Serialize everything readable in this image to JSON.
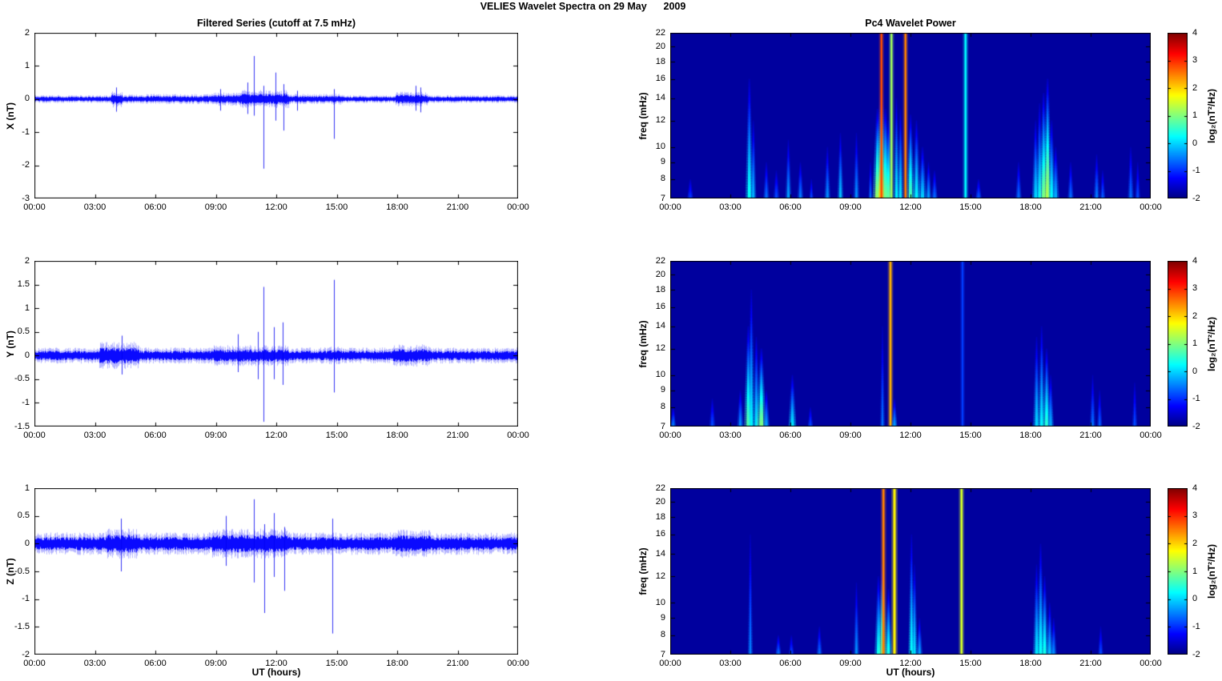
{
  "figure": {
    "title": "VELIES Wavelet Spectra on 29 May      2009",
    "background": "#ffffff"
  },
  "chart_data": {
    "type": "multi-panel",
    "panel_types": [
      "line",
      "heatmap"
    ],
    "left_title": "Filtered Series (cutoff at 7.5 mHz)",
    "right_title": "Pc4 Wavelet Power",
    "xlabel": "UT (hours)",
    "freq_label": "freq (mHz)",
    "series_color": "#0000ff",
    "frame_color": "#000000",
    "time_axis": {
      "range_hours": [
        0,
        24
      ],
      "tick_hours": [
        0,
        3,
        6,
        9,
        12,
        15,
        18,
        21,
        24
      ],
      "tick_labels": [
        "00:00",
        "03:00",
        "06:00",
        "09:00",
        "12:00",
        "15:00",
        "18:00",
        "21:00",
        "00:00"
      ]
    },
    "timeseries": [
      {
        "name": "X",
        "ylabel": "X (nT)",
        "ylim": [
          -3,
          2
        ],
        "ytick_values": [
          2,
          1,
          0,
          -1,
          -2,
          -3
        ],
        "ytick_labels": [
          "2",
          "1",
          "0",
          "-1",
          "-2",
          "-3"
        ],
        "noise_segments": [
          [
            0,
            3.8,
            0.07
          ],
          [
            3.8,
            4.35,
            0.15
          ],
          [
            4.35,
            5.5,
            0.08
          ],
          [
            5.5,
            8.8,
            0.09
          ],
          [
            8.8,
            10.2,
            0.12
          ],
          [
            10.2,
            12.6,
            0.16
          ],
          [
            12.6,
            14.4,
            0.09
          ],
          [
            14.4,
            15.3,
            0.1
          ],
          [
            15.3,
            17.9,
            0.07
          ],
          [
            17.9,
            19.5,
            0.13
          ],
          [
            19.5,
            24,
            0.07
          ]
        ],
        "spikes": [
          [
            4.05,
            0.35,
            -0.38
          ],
          [
            9.2,
            0.3,
            -0.35
          ],
          [
            10.55,
            0.5,
            -0.45
          ],
          [
            10.9,
            1.3,
            -0.5
          ],
          [
            11.35,
            0.4,
            -2.1
          ],
          [
            11.95,
            0.8,
            -0.65
          ],
          [
            12.35,
            0.45,
            -0.95
          ],
          [
            13.05,
            0.25,
            -0.35
          ],
          [
            14.85,
            0.3,
            -1.2
          ],
          [
            18.9,
            0.4,
            -0.35
          ],
          [
            19.15,
            0.35,
            -0.4
          ]
        ]
      },
      {
        "name": "Y",
        "ylabel": "Y (nT)",
        "ylim": [
          -1.5,
          2
        ],
        "ytick_values": [
          2,
          1.5,
          1,
          0.5,
          0,
          -0.5,
          -1,
          -1.5
        ],
        "ytick_labels": [
          "2",
          "1.5",
          "1",
          "0.5",
          "0",
          "-0.5",
          "-1",
          "-1.5"
        ],
        "noise_segments": [
          [
            0,
            3.2,
            0.1
          ],
          [
            3.2,
            5.2,
            0.17
          ],
          [
            5.2,
            8.9,
            0.1
          ],
          [
            8.9,
            12.6,
            0.13
          ],
          [
            12.6,
            14.5,
            0.1
          ],
          [
            14.5,
            15.1,
            0.11
          ],
          [
            15.1,
            17.8,
            0.1
          ],
          [
            17.8,
            19.6,
            0.14
          ],
          [
            19.6,
            24,
            0.1
          ]
        ],
        "spikes": [
          [
            4.35,
            0.42,
            -0.4
          ],
          [
            10.1,
            0.45,
            -0.35
          ],
          [
            11.1,
            0.5,
            -0.5
          ],
          [
            11.35,
            1.45,
            -1.4
          ],
          [
            11.9,
            0.6,
            -0.5
          ],
          [
            12.3,
            0.7,
            -0.62
          ],
          [
            14.85,
            1.6,
            -0.78
          ]
        ]
      },
      {
        "name": "Z",
        "ylabel": "Z (nT)",
        "ylim": [
          -2,
          1
        ],
        "ytick_values": [
          1,
          0.5,
          0,
          -0.5,
          -1,
          -1.5,
          -2
        ],
        "ytick_labels": [
          "1",
          "0.5",
          "0",
          "-0.5",
          "-1",
          "-1.5",
          "-2"
        ],
        "noise_segments": [
          [
            0,
            3.5,
            0.12
          ],
          [
            3.5,
            5.1,
            0.16
          ],
          [
            5.1,
            8.8,
            0.12
          ],
          [
            8.8,
            12.6,
            0.16
          ],
          [
            12.6,
            17.9,
            0.12
          ],
          [
            17.9,
            19.6,
            0.15
          ],
          [
            19.6,
            24,
            0.12
          ]
        ],
        "spikes": [
          [
            4.3,
            0.45,
            -0.5
          ],
          [
            9.5,
            0.5,
            -0.4
          ],
          [
            10.9,
            0.8,
            -0.7
          ],
          [
            11.4,
            0.35,
            -1.25
          ],
          [
            11.9,
            0.55,
            -0.6
          ],
          [
            12.4,
            0.3,
            -0.85
          ],
          [
            14.8,
            0.45,
            -1.62
          ]
        ]
      }
    ],
    "spectrograms": [
      {
        "name": "X",
        "flim": [
          7,
          22
        ],
        "fscale": "log",
        "ftick_values": [
          22,
          20,
          18,
          16,
          14,
          12,
          10,
          9,
          8,
          7
        ],
        "ftick_labels": [
          "22",
          "20",
          "18",
          "16",
          "14",
          "12",
          "10",
          "9",
          "8",
          "7"
        ],
        "background_value": -1.82,
        "events": [
          [
            1.0,
            8,
            -0.9,
            1.5
          ],
          [
            3.95,
            16,
            0.3,
            2
          ],
          [
            4.15,
            12,
            -0.2,
            1.5
          ],
          [
            4.8,
            9,
            -0.6,
            1.5
          ],
          [
            5.3,
            8.5,
            -0.8,
            1.5
          ],
          [
            5.9,
            10.5,
            -0.3,
            1.5
          ],
          [
            6.5,
            9,
            -0.5,
            1.5
          ],
          [
            7.05,
            8,
            -0.8,
            1
          ],
          [
            7.85,
            10,
            -0.4,
            1.5
          ],
          [
            8.5,
            11,
            -0.1,
            1.5
          ],
          [
            9.3,
            11,
            -0.4,
            1.5
          ],
          [
            10.0,
            9,
            -0.6,
            1
          ],
          [
            10.35,
            13,
            0.9,
            2.5
          ],
          [
            10.55,
            14.5,
            1.6,
            3.5
          ],
          [
            10.75,
            13,
            1.0,
            2.5
          ],
          [
            10.55,
            22,
            2.8,
            1.2
          ],
          [
            10.9,
            12,
            0.8,
            2
          ],
          [
            11.05,
            22,
            1.2,
            1.2
          ],
          [
            11.3,
            14,
            0.2,
            1.5
          ],
          [
            11.5,
            13,
            0.1,
            1.5
          ],
          [
            11.75,
            22,
            2.5,
            1.2
          ],
          [
            12.0,
            12.5,
            0.7,
            2
          ],
          [
            12.3,
            12,
            0.2,
            2
          ],
          [
            12.6,
            10,
            0.0,
            2
          ],
          [
            12.9,
            9,
            -0.3,
            1.5
          ],
          [
            13.2,
            8.5,
            -0.6,
            1.5
          ],
          [
            14.75,
            22,
            0.2,
            1.3
          ],
          [
            15.4,
            8,
            -0.7,
            1.5
          ],
          [
            17.4,
            9,
            -0.6,
            1.5
          ],
          [
            18.25,
            12,
            0.0,
            1.8
          ],
          [
            18.45,
            13.5,
            0.2,
            1.8
          ],
          [
            18.65,
            14.5,
            0.9,
            2.2
          ],
          [
            18.85,
            16,
            1.3,
            2.2
          ],
          [
            19.05,
            12,
            0.3,
            1.8
          ],
          [
            19.25,
            10,
            -0.2,
            1.8
          ],
          [
            20.0,
            9,
            -0.6,
            1.5
          ],
          [
            21.3,
            9.5,
            -0.5,
            1.5
          ],
          [
            21.6,
            8.5,
            -0.7,
            1.3
          ],
          [
            23.0,
            10,
            -0.6,
            1.5
          ],
          [
            23.35,
            9,
            -0.8,
            1.3
          ]
        ]
      },
      {
        "name": "Y",
        "flim": [
          7,
          22
        ],
        "fscale": "log",
        "ftick_values": [
          22,
          20,
          18,
          16,
          14,
          12,
          10,
          9,
          8,
          7
        ],
        "ftick_labels": [
          "22",
          "20",
          "18",
          "16",
          "14",
          "12",
          "10",
          "9",
          "8",
          "7"
        ],
        "background_value": -1.82,
        "events": [
          [
            0.15,
            8,
            -0.5,
            1.3
          ],
          [
            2.1,
            8.5,
            -0.8,
            1.5
          ],
          [
            3.5,
            9,
            -0.4,
            1.6
          ],
          [
            3.9,
            14,
            0.8,
            2.2
          ],
          [
            4.05,
            18,
            0.2,
            1.8
          ],
          [
            4.3,
            13,
            0.1,
            1.8
          ],
          [
            4.55,
            12,
            1.0,
            2.4
          ],
          [
            4.8,
            9,
            -0.3,
            1.6
          ],
          [
            6.1,
            10,
            0.1,
            2.0
          ],
          [
            7.0,
            8,
            -0.8,
            1.3
          ],
          [
            10.6,
            14,
            -0.6,
            1.2
          ],
          [
            11.0,
            22,
            2.2,
            1.3
          ],
          [
            11.2,
            8.5,
            -0.3,
            1.4
          ],
          [
            14.6,
            22,
            -0.9,
            1.1
          ],
          [
            18.3,
            13,
            0.0,
            1.8
          ],
          [
            18.55,
            14,
            0.2,
            1.8
          ],
          [
            18.8,
            12,
            0.5,
            2.0
          ],
          [
            19.0,
            10,
            -0.2,
            1.6
          ],
          [
            21.1,
            10,
            -0.6,
            1.4
          ],
          [
            21.45,
            9,
            -0.7,
            1.3
          ],
          [
            23.2,
            9.5,
            -0.8,
            1.3
          ]
        ]
      },
      {
        "name": "Z",
        "flim": [
          7,
          22
        ],
        "fscale": "log",
        "ftick_values": [
          22,
          20,
          18,
          16,
          14,
          12,
          10,
          9,
          8,
          7
        ],
        "ftick_labels": [
          "22",
          "20",
          "18",
          "16",
          "14",
          "12",
          "10",
          "9",
          "8",
          "7"
        ],
        "background_value": -1.82,
        "events": [
          [
            4.0,
            16,
            -0.5,
            1.3
          ],
          [
            5.4,
            8,
            -0.6,
            1.4
          ],
          [
            6.05,
            8,
            -0.8,
            1.3
          ],
          [
            7.45,
            8.5,
            -0.6,
            1.4
          ],
          [
            9.3,
            11.5,
            -0.4,
            1.4
          ],
          [
            10.4,
            12,
            0.3,
            2.0
          ],
          [
            10.6,
            13,
            0.8,
            2.4
          ],
          [
            10.65,
            22,
            2.5,
            1.3
          ],
          [
            10.9,
            11,
            0.4,
            1.8
          ],
          [
            11.2,
            22,
            1.8,
            1.5
          ],
          [
            12.05,
            16,
            0.3,
            1.6
          ],
          [
            12.2,
            13,
            0.1,
            1.5
          ],
          [
            12.45,
            9,
            -0.3,
            1.5
          ],
          [
            14.55,
            22,
            1.5,
            1.3
          ],
          [
            18.3,
            13,
            0.1,
            1.8
          ],
          [
            18.5,
            15,
            0.3,
            1.8
          ],
          [
            18.7,
            12,
            0.4,
            1.9
          ],
          [
            18.95,
            10,
            -0.1,
            1.7
          ],
          [
            19.15,
            9,
            -0.4,
            1.5
          ],
          [
            21.5,
            8.5,
            -0.8,
            1.3
          ]
        ]
      }
    ],
    "colorbar": {
      "label": "log₂(nT²/Hz)",
      "range": [
        -2,
        4
      ],
      "tick_values": [
        4,
        3,
        2,
        1,
        0,
        -1,
        -2
      ],
      "tick_labels": [
        "4",
        "3",
        "2",
        "1",
        "0",
        "-1",
        "-2"
      ],
      "colormap": "jet"
    }
  }
}
